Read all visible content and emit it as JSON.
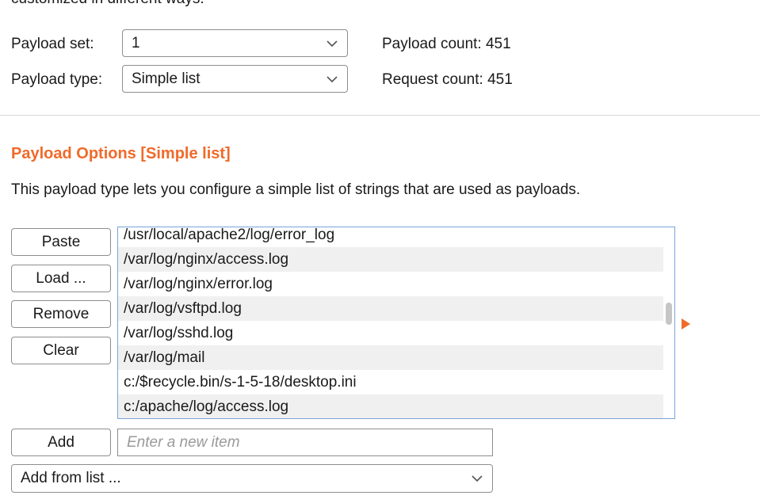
{
  "header": {
    "truncated_text": "customized in different ways.",
    "payload_set_label": "Payload set:",
    "payload_set_value": "1",
    "payload_count_label": "Payload count:",
    "payload_count_value": "451",
    "payload_type_label": "Payload type:",
    "payload_type_value": "Simple list",
    "request_count_label": "Request count:",
    "request_count_value": "451"
  },
  "options": {
    "title": "Payload Options [Simple list]",
    "description": "This payload type lets you configure a simple list of strings that are used as payloads.",
    "buttons": {
      "paste": "Paste",
      "load": "Load ...",
      "remove": "Remove",
      "clear": "Clear",
      "add": "Add"
    },
    "items": [
      "/usr/local/apache2/log/error_log",
      "/var/log/nginx/access.log",
      "/var/log/nginx/error.log",
      "/var/log/vsftpd.log",
      "/var/log/sshd.log",
      "/var/log/mail",
      "c:/$recycle.bin/s-1-5-18/desktop.ini",
      "c:/apache/log/access.log"
    ],
    "new_item_placeholder": "Enter a new item",
    "add_from_list_value": "Add from list ..."
  },
  "colors": {
    "accent": "#f06a2a",
    "list_border": "#7aa3d6",
    "row_alt": "#f0f0f0"
  }
}
